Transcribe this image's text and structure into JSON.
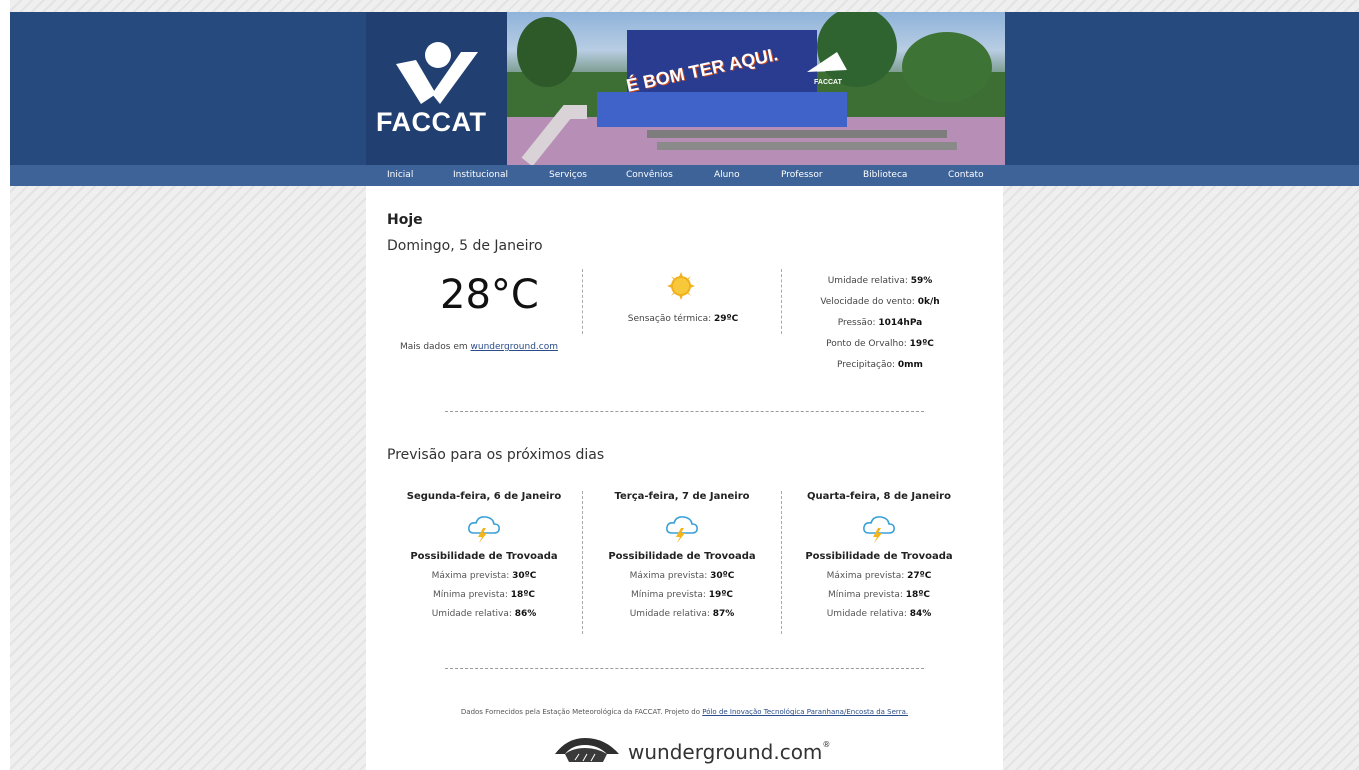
{
  "colors": {
    "header_bg": "#274a7e",
    "nav_bg": "#3d6398",
    "link": "#2a4c8a",
    "sun": "#f2b01e",
    "bolt": "#f4b41a"
  },
  "header": {
    "logo_text": "FACCAT",
    "banner_text": "É BOM TER AQUI."
  },
  "nav": {
    "items": [
      "Inicial",
      "Institucional",
      "Serviços",
      "Convênios",
      "Aluno",
      "Professor",
      "Biblioteca",
      "Contato"
    ]
  },
  "today": {
    "heading": "Hoje",
    "date": "Domingo, 5 de Janeiro",
    "temperature": "28°C",
    "more_prefix": "Mais dados em ",
    "more_link": "wunderground.com",
    "icon": "sun-icon",
    "feels_label": "Sensação térmica: ",
    "feels_value": "29ºC",
    "stats": [
      {
        "label": "Umidade relativa: ",
        "value": "59%"
      },
      {
        "label": "Velocidade do vento: ",
        "value": "0k/h"
      },
      {
        "label": "Pressão: ",
        "value": "1014hPa"
      },
      {
        "label": "Ponto de Orvalho: ",
        "value": "19ºC"
      },
      {
        "label": "Precipitação: ",
        "value": "0mm"
      }
    ]
  },
  "forecast": {
    "heading": "Previsão para os próximos dias",
    "labels": {
      "max": "Máxima prevista: ",
      "min": "Mínima prevista: ",
      "humidity": "Umidade relativa: "
    },
    "days": [
      {
        "title": "Segunda-feira, 6 de Janeiro",
        "icon": "thunderstorm-icon",
        "condition": "Possibilidade de Trovoada",
        "max": "30ºC",
        "min": "18ºC",
        "humidity": "86%"
      },
      {
        "title": "Terça-feira, 7 de Janeiro",
        "icon": "thunderstorm-icon",
        "condition": "Possibilidade de Trovoada",
        "max": "30ºC",
        "min": "19ºC",
        "humidity": "87%"
      },
      {
        "title": "Quarta-feira, 8 de Janeiro",
        "icon": "thunderstorm-icon",
        "condition": "Possibilidade de Trovoada",
        "max": "27ºC",
        "min": "18ºC",
        "humidity": "84%"
      }
    ]
  },
  "footer": {
    "note_prefix": "Dados Fornecidos pela Estação Meteorológica da FACCAT. Projeto do ",
    "note_link": "Pólo de Inovação Tecnológica Paranhana/Encosta da Serra.",
    "brand": "wunderground.com",
    "reg": "®"
  }
}
